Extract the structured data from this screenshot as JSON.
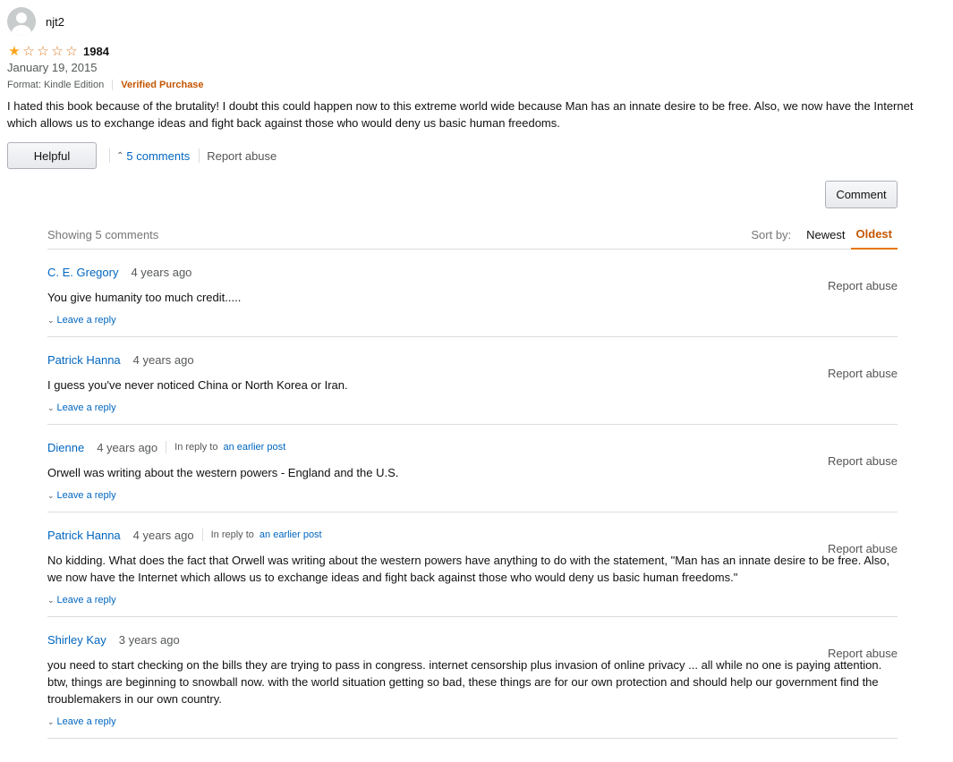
{
  "review": {
    "author": "njt2",
    "rating": 1,
    "max_rating": 5,
    "title": "1984",
    "date": "January 19, 2015",
    "format": "Format: Kindle Edition",
    "verified": "Verified Purchase",
    "body": "I hated this book because of the brutality! I doubt this could happen now to this extreme world wide because Man has an innate desire to be free. Also, we now have the Internet which allows us to exchange ideas and fight back against those who would deny us basic human freedoms.",
    "helpful_label": "Helpful",
    "comments_link": "5 comments",
    "report_label": "Report abuse"
  },
  "comment_button": "Comment",
  "thread": {
    "showing": "Showing 5 comments",
    "sort_label": "Sort by:",
    "sort_options": [
      "Newest",
      "Oldest"
    ],
    "active_sort": "Oldest",
    "comments": [
      {
        "author": "C. E. Gregory",
        "time": "4 years ago",
        "in_reply_to": null,
        "body": "You give humanity too much credit.....",
        "report": "Report abuse",
        "reply": "Leave a reply"
      },
      {
        "author": "Patrick Hanna",
        "time": "4 years ago",
        "in_reply_to": null,
        "body": "I guess you've never noticed China or North Korea or Iran.",
        "report": "Report abuse",
        "reply": "Leave a reply"
      },
      {
        "author": "Dienne",
        "time": "4 years ago",
        "in_reply_to": {
          "prefix": "In reply to",
          "link": "an earlier post"
        },
        "body": "Orwell was writing about the western powers - England and the U.S.",
        "report": "Report abuse",
        "reply": "Leave a reply"
      },
      {
        "author": "Patrick Hanna",
        "time": "4 years ago",
        "in_reply_to": {
          "prefix": "In reply to",
          "link": "an earlier post"
        },
        "body": "No kidding. What does the fact that Orwell was writing about the western powers have anything to do with the statement, \"Man has an innate desire to be free. Also, we now have the Internet which allows us to exchange ideas and fight back against those who would deny us basic human freedoms.\"",
        "report": "Report abuse",
        "reply": "Leave a reply"
      },
      {
        "author": "Shirley Kay",
        "time": "3 years ago",
        "in_reply_to": null,
        "body": "you need to start checking on the bills they are trying to pass in congress. internet censorship plus invasion of online privacy ... all while no one is paying attention. btw, things are beginning to snowball now. with the world situation getting so bad, these things are for our own protection and should help our government find the troublemakers in our own country.",
        "report": "Report abuse",
        "reply": "Leave a reply"
      }
    ]
  },
  "colors": {
    "link": "#0066c0",
    "verified": "#c45500",
    "star": "#ffa41c",
    "active_sort": "#c45500"
  }
}
